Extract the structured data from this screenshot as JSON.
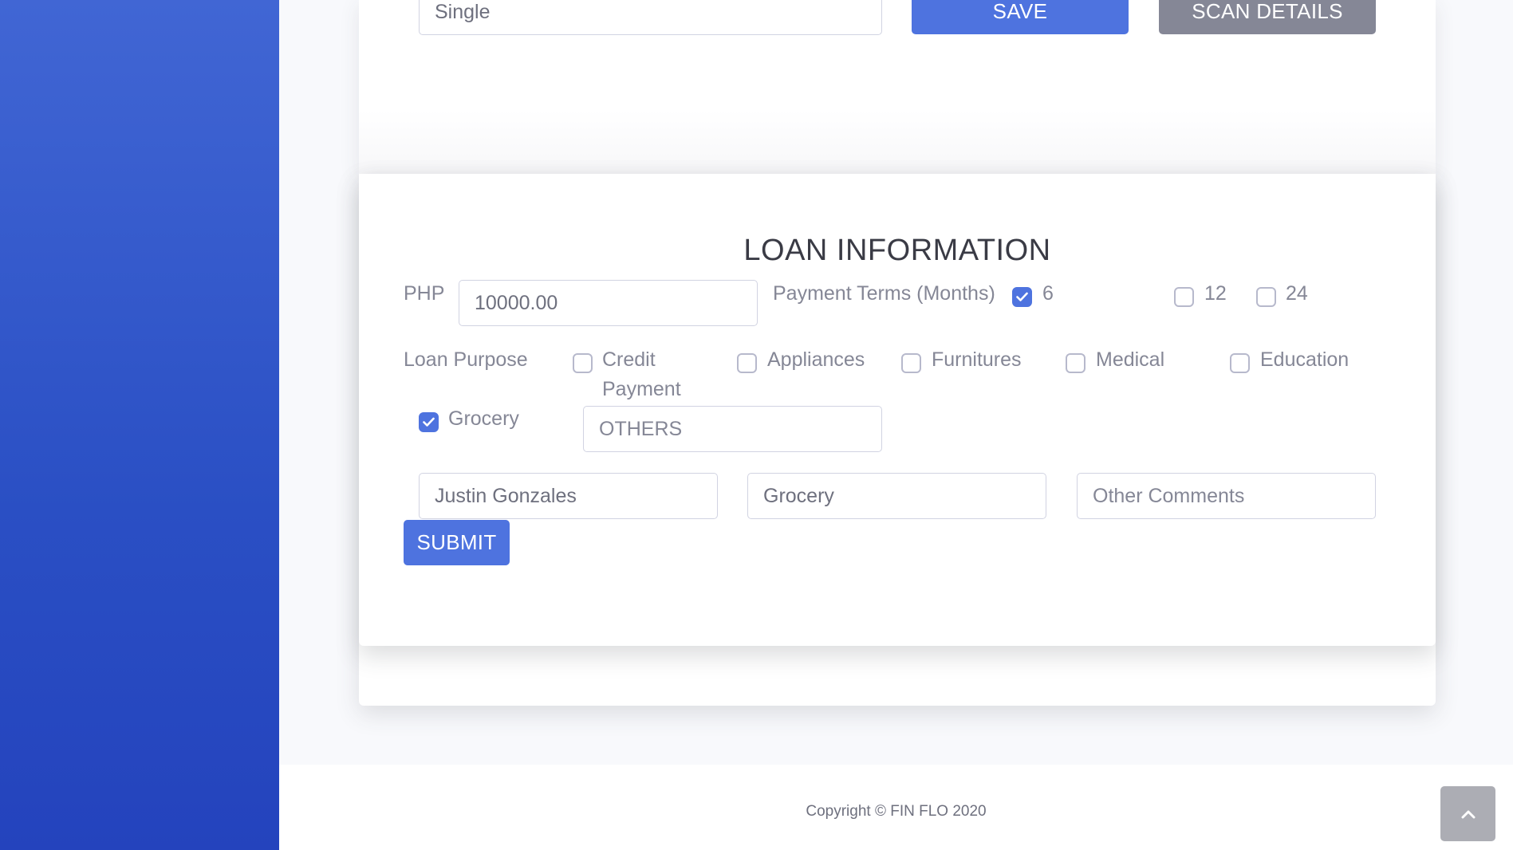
{
  "personal_section": {
    "civil_status_value": "Single",
    "save_label": "SAVE",
    "scan_details_label": "SCAN DETAILS"
  },
  "loan": {
    "heading": "LOAN INFORMATION",
    "currency_label": "PHP",
    "amount_value": "10000.00",
    "payment_terms_label": "Payment Terms (Months)",
    "terms": [
      {
        "label": "6",
        "checked": true
      },
      {
        "label": "12",
        "checked": false
      },
      {
        "label": "24",
        "checked": false
      }
    ],
    "purpose_label": "Loan Purpose",
    "purposes": [
      {
        "label_line1": "Credit",
        "label_line2": "Payment",
        "checked": false
      },
      {
        "label": "Appliances",
        "checked": false
      },
      {
        "label": "Furnitures",
        "checked": false
      },
      {
        "label": "Medical",
        "checked": false
      },
      {
        "label": "Education",
        "checked": false
      },
      {
        "label": "Grocery",
        "checked": true
      }
    ],
    "others_placeholder": "OTHERS",
    "name_value": "Justin Gonzales",
    "purpose_value": "Grocery",
    "comments_placeholder": "Other Comments",
    "submit_label": "SUBMIT"
  },
  "footer": {
    "copyright": "Copyright © FIN FLO 2020"
  },
  "icons": {
    "scroll_top": "chevron-up-icon",
    "check": "check-icon"
  },
  "colors": {
    "primary": "#4e73df",
    "secondary": "#858796",
    "sidebar_top": "#4166d4",
    "sidebar_bottom": "#2443bd"
  }
}
